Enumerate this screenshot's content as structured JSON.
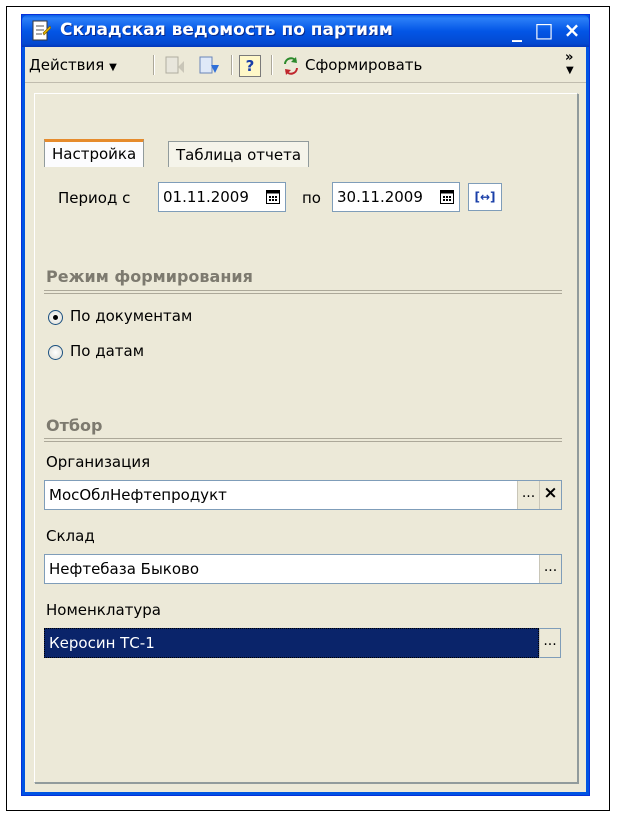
{
  "window": {
    "title": "Складская ведомость по партиям",
    "minimize": "_",
    "maximize": "□",
    "close": "×"
  },
  "toolbar": {
    "actions_label": "Действия",
    "help_label": "?",
    "generate_label": "Сформировать",
    "more_label": "»"
  },
  "tabs": [
    {
      "label": "Настройка",
      "active": true
    },
    {
      "label": "Таблица отчета",
      "active": false
    }
  ],
  "period": {
    "from_label": "Период с",
    "from_value": "01.11.2009",
    "to_label": "по",
    "to_value": "30.11.2009",
    "range_button": "[↔]"
  },
  "mode": {
    "title": "Режим формирования",
    "options": [
      {
        "label": "По документам",
        "checked": true
      },
      {
        "label": "По датам",
        "checked": false
      }
    ]
  },
  "filter": {
    "title": "Отбор",
    "organization_label": "Организация",
    "organization_value": "МосОблНефтепродукт",
    "warehouse_label": "Склад",
    "warehouse_value": "Нефтебаза Быково",
    "nomenclature_label": "Номенклатура",
    "nomenclature_value": "Керосин ТС-1",
    "choose_button": "...",
    "clear_button": "×"
  },
  "icons": [
    "document-icon",
    "calendar-icon",
    "refresh-icon",
    "help-icon",
    "move-up-icon",
    "move-down-icon"
  ],
  "colors": {
    "titlebar": "#0356e6",
    "window_bg": "#ece9d8",
    "selection": "#0a246a",
    "tab_accent": "#e68b2c"
  }
}
